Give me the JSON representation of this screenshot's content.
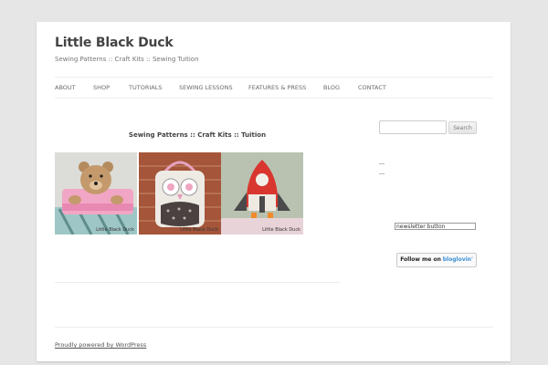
{
  "site": {
    "title": "Little Black Duck",
    "description": "Sewing Patterns :: Craft Kits :: Sewing Tuition"
  },
  "nav": {
    "items": [
      "ABOUT",
      "SHOP",
      "TUTORIALS",
      "SEWING LESSONS",
      "FEATURES & PRESS",
      "BLOG",
      "CONTACT"
    ]
  },
  "main": {
    "entry_title": "Sewing Patterns :: Craft Kits :: Tuition",
    "gallery": [
      {
        "alt": "teddy bear in sleeping bag",
        "watermark": "Little Black Duck"
      },
      {
        "alt": "owl bag",
        "watermark": "Little Black Duck"
      },
      {
        "alt": "rocket",
        "watermark": "Little Black Duck"
      }
    ]
  },
  "sidebar": {
    "search_placeholder": "",
    "search_button": "Search",
    "newsletter_label": "newsletter button",
    "bloglovin_follow": "Follow me on",
    "bloglovin_brand": "bloglovin'"
  },
  "footer": {
    "credit": "Proudly powered by WordPress"
  },
  "colors": {
    "background": "#e6e6e6",
    "page": "#ffffff",
    "text": "#444444",
    "accent": "#3a8fd6"
  }
}
